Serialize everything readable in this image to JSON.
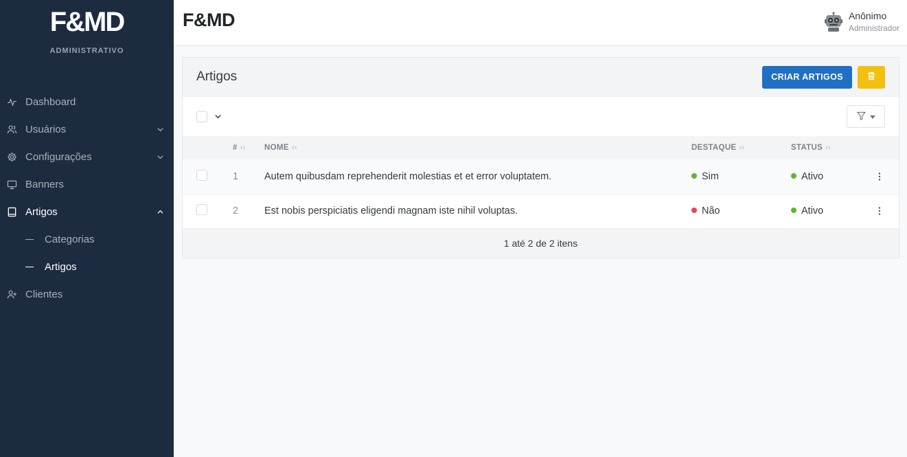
{
  "brand": {
    "logo": "F&MD",
    "subtitle": "ADMINISTRATIVO"
  },
  "sidebar": {
    "items": [
      {
        "label": "Dashboard",
        "icon": "activity-icon"
      },
      {
        "label": "Usuários",
        "icon": "users-icon"
      },
      {
        "label": "Configurações",
        "icon": "gear-icon"
      },
      {
        "label": "Banners",
        "icon": "monitor-icon"
      },
      {
        "label": "Artigos",
        "icon": "book-icon"
      },
      {
        "label": "Clientes",
        "icon": "user-plus-icon"
      }
    ],
    "subitems": [
      {
        "label": "Categorias"
      },
      {
        "label": "Artigos"
      }
    ]
  },
  "header": {
    "title": "F&MD"
  },
  "user": {
    "name": "Anônimo",
    "role": "Administrador"
  },
  "card": {
    "title": "Artigos",
    "create_label": "CRIAR ARTIGOS",
    "columns": {
      "id": "#",
      "name": "NOME",
      "featured": "DESTAQUE",
      "status": "STATUS"
    },
    "rows": [
      {
        "id": "1",
        "name": "Autem quibusdam reprehenderit molestias et et error voluptatem.",
        "featured": "Sim",
        "status": "Ativo"
      },
      {
        "id": "2",
        "name": "Est nobis perspiciatis eligendi magnam iste nihil voluptas.",
        "featured": "Não",
        "status": "Ativo"
      }
    ],
    "footer": "1 até 2 de 2 itens"
  },
  "colors": {
    "sidebar_bg": "#1d2b40",
    "primary": "#1f6fc5",
    "warning": "#f2c10f",
    "success_dot": "#5cb82e",
    "danger_dot": "#e8475a"
  }
}
